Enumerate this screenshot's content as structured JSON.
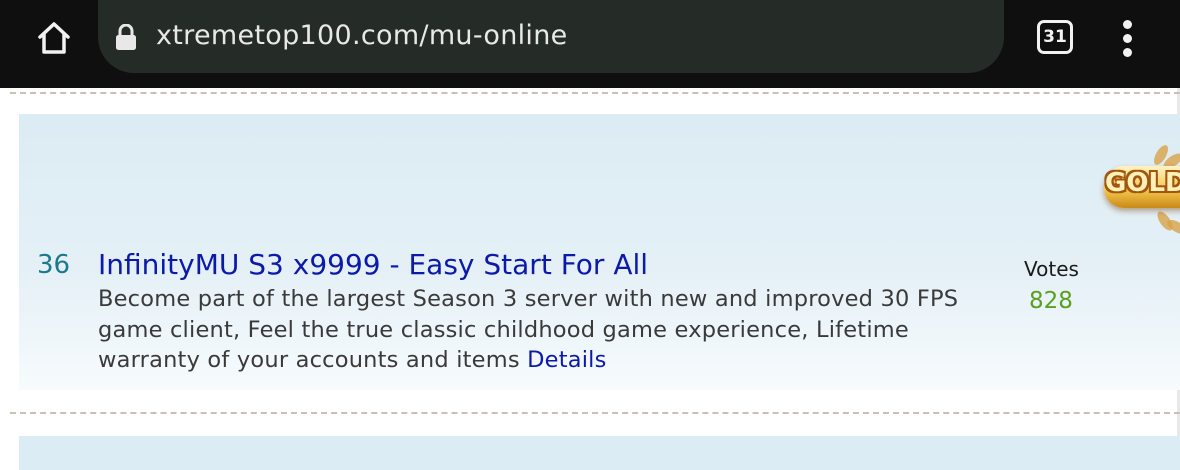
{
  "browser": {
    "url": "xtremetop100.com/mu-online",
    "tab_count": "31",
    "icons": [
      "home-icon",
      "lock-icon",
      "tabs-icon",
      "overflow-menu-icon"
    ]
  },
  "listing": {
    "rank": "36",
    "title": "InfinityMU S3 x9999 - Easy Start For All",
    "description": "Become part of the largest Season 3 server with new and improved 30 FPS game client, Feel the true classic childhood game experience, Lifetime warranty of your accounts and items",
    "details_link": "Details",
    "votes_label": "Votes",
    "votes_count": "828",
    "badge_text": "GOLD"
  },
  "colors": {
    "topbar": "#0f0f0f",
    "urlbar": "#252c27",
    "card_bg": "#dcecf4",
    "title_link": "#0b1aa8",
    "rank": "#1a7a8c",
    "votes_count": "#5aa01e"
  }
}
